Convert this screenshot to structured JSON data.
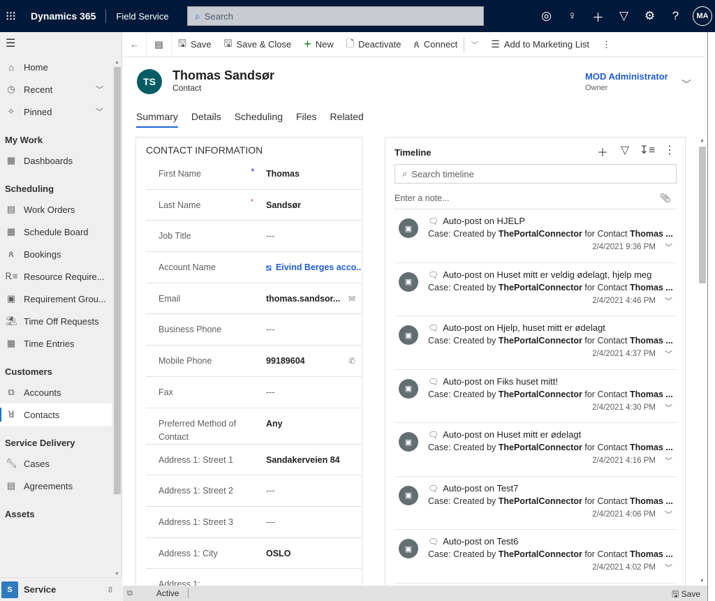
{
  "topbar": {
    "app_name": "Dynamics 365",
    "module_name": "Field Service",
    "search_placeholder": "Search",
    "icons": [
      "task-flow-icon",
      "lightbulb-icon",
      "plus-icon",
      "filter-icon",
      "settings-icon",
      "help-icon"
    ],
    "user_initials": "MA"
  },
  "sidebar": {
    "top_items": [
      {
        "label": "Home",
        "icon": "home-icon"
      },
      {
        "label": "Recent",
        "icon": "clock-icon",
        "expandable": true
      },
      {
        "label": "Pinned",
        "icon": "pin-icon",
        "expandable": true
      }
    ],
    "groups": [
      {
        "title": "My Work",
        "items": [
          {
            "label": "Dashboards",
            "icon": "dashboard-icon"
          }
        ]
      },
      {
        "title": "Scheduling",
        "items": [
          {
            "label": "Work Orders",
            "icon": "clipboard-icon"
          },
          {
            "label": "Schedule Board",
            "icon": "calendar-icon"
          },
          {
            "label": "Bookings",
            "icon": "people-icon"
          },
          {
            "label": "Resource Require...",
            "icon": "resource-list-icon"
          },
          {
            "label": "Requirement Grou...",
            "icon": "id-card-icon"
          },
          {
            "label": "Time Off Requests",
            "icon": "beach-icon"
          },
          {
            "label": "Time Entries",
            "icon": "calendar-icon"
          }
        ]
      },
      {
        "title": "Customers",
        "items": [
          {
            "label": "Accounts",
            "icon": "account-icon"
          },
          {
            "label": "Contacts",
            "icon": "person-icon",
            "active": true
          }
        ]
      },
      {
        "title": "Service Delivery",
        "items": [
          {
            "label": "Cases",
            "icon": "wrench-icon"
          },
          {
            "label": "Agreements",
            "icon": "document-icon"
          }
        ]
      },
      {
        "title": "Assets",
        "items": []
      }
    ],
    "area": {
      "badge": "S",
      "name": "Service"
    }
  },
  "commandbar": {
    "save": "Save",
    "save_close": "Save & Close",
    "new": "New",
    "deactivate": "Deactivate",
    "connect": "Connect",
    "add_marketing": "Add to Marketing List"
  },
  "record": {
    "initials": "TS",
    "name": "Thomas Sandsør",
    "type": "Contact",
    "owner_name": "MOD Administrator",
    "owner_label": "Owner",
    "avatar_color": "#035c63"
  },
  "tabs": [
    {
      "label": "Summary",
      "active": true
    },
    {
      "label": "Details"
    },
    {
      "label": "Scheduling"
    },
    {
      "label": "Files"
    },
    {
      "label": "Related"
    }
  ],
  "contact_section": {
    "title": "CONTACT INFORMATION",
    "fields": [
      {
        "label": "First Name",
        "value": "Thomas",
        "req": "+",
        "req_color": "#0000cc"
      },
      {
        "label": "Last Name",
        "value": "Sandsør",
        "req": "*",
        "req_color": "#d13438"
      },
      {
        "label": "Job Title",
        "value": "---"
      },
      {
        "label": "Account Name",
        "value": "Eivind Berges acco...",
        "link": true
      },
      {
        "label": "Email",
        "value": "thomas.sandsor...",
        "action": "email-icon"
      },
      {
        "label": "Business Phone",
        "value": "---"
      },
      {
        "label": "Mobile Phone",
        "value": "99189604",
        "action": "phone-icon"
      },
      {
        "label": "Fax",
        "value": "---"
      },
      {
        "label": "Preferred Method of Contact",
        "value": "Any"
      },
      {
        "label": "Address 1: Street 1",
        "value": "Sandakerveien 84"
      },
      {
        "label": "Address 1: Street 2",
        "value": "---"
      },
      {
        "label": "Address 1: Street 3",
        "value": "---"
      },
      {
        "label": "Address 1: City",
        "value": "OSLO"
      },
      {
        "label": "Address 1:",
        "value": ""
      }
    ]
  },
  "timeline": {
    "title": "Timeline",
    "search_placeholder": "Search timeline",
    "note_placeholder": "Enter a note...",
    "items": [
      {
        "title": "Auto-post on HJELP",
        "prefix": "Case: Created by ",
        "creator": "ThePortalConnector",
        "mid": " for Contact ",
        "contact": "Thomas ...",
        "time": "2/4/2021 9:36 PM"
      },
      {
        "title": "Auto-post on Huset mitt er veldig ødelagt, hjelp meg",
        "prefix": "Case: Created by ",
        "creator": "ThePortalConnector",
        "mid": " for Contact ",
        "contact": "Thomas ...",
        "time": "2/4/2021 4:46 PM"
      },
      {
        "title": "Auto-post on Hjelp, huset mitt er ødelagt",
        "prefix": "Case: Created by ",
        "creator": "ThePortalConnector",
        "mid": " for Contact ",
        "contact": "Thomas ...",
        "time": "2/4/2021 4:37 PM"
      },
      {
        "title": "Auto-post on Fiks huset mitt!",
        "prefix": "Case: Created by ",
        "creator": "ThePortalConnector",
        "mid": " for Contact ",
        "contact": "Thomas ...",
        "time": "2/4/2021 4:30 PM"
      },
      {
        "title": "Auto-post on Huset mitt er ødelagt",
        "prefix": "Case: Created by ",
        "creator": "ThePortalConnector",
        "mid": " for Contact ",
        "contact": "Thomas ...",
        "time": "2/4/2021 4:16 PM"
      },
      {
        "title": "Auto-post on Test7",
        "prefix": "Case: Created by ",
        "creator": "ThePortalConnector",
        "mid": " for Contact ",
        "contact": "Thomas ...",
        "time": "2/4/2021 4:06 PM"
      },
      {
        "title": "Auto-post on Test6",
        "prefix": "Case: Created by ",
        "creator": "ThePortalConnector",
        "mid": " for Contact ",
        "contact": "Thomas ...",
        "time": "2/4/2021 4:02 PM"
      }
    ]
  },
  "statusbar": {
    "status": "Active",
    "save": "Save"
  }
}
